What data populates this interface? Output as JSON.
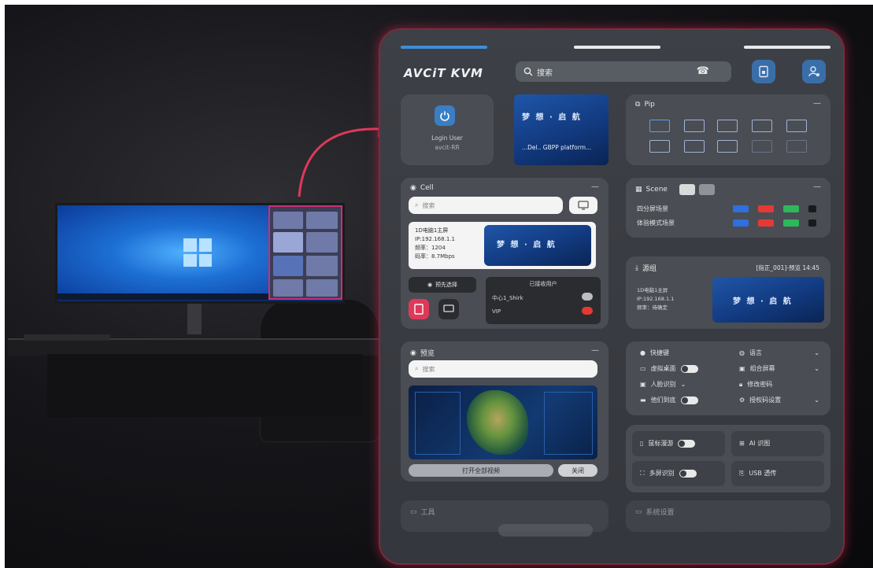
{
  "app": {
    "logo": "AVCiT KVM"
  },
  "search": {
    "placeholder": "搜索"
  },
  "login_card": {
    "title": "Login User",
    "user": "avcit-RR"
  },
  "thumb_top": {
    "caption": "...Del.. GBPP platform..."
  },
  "pip_card": {
    "title": "Pip"
  },
  "cell_card": {
    "title": "Cell",
    "search_placeholder": "搜索",
    "info": [
      "1D电脑1主屏",
      "IP:192.168.1.1",
      "频率：1204",
      "码率：8.7Mbps"
    ],
    "btn_left": "预先选择",
    "cluster_title": "已接收用户",
    "user1": "中心1_Shirk",
    "user2": "VIP"
  },
  "scene_card": {
    "title": "Scene",
    "rows": [
      "四分屏场景",
      "体验模式场景"
    ]
  },
  "source_card": {
    "title": "源组",
    "meta": "[指正_001]-预览 14:45",
    "info": [
      "1D电脑1主屏",
      "IP:192.168.1.1",
      "频率：待确定"
    ]
  },
  "monitor_card": {
    "title": "预览",
    "search_placeholder": "搜索",
    "bottom_btn": "打开全部视频",
    "bottom_pill": "关闭"
  },
  "settings_card": {
    "items": [
      {
        "label": "快捷键",
        "right": "语言"
      },
      {
        "label": "虚拟桌面",
        "right": "组合屏幕"
      },
      {
        "label": "人脸识别",
        "right": "修改密码"
      },
      {
        "label": "他们到底",
        "right": "授权码设置"
      }
    ]
  },
  "tools_card": {
    "items": [
      "鼠标漫游",
      "AI 识图",
      "多屏识别",
      "USB 透传"
    ]
  },
  "footer_card": {
    "left": "工具",
    "right": "系统设置"
  },
  "colors": {
    "accent_red": "#e0385a",
    "tag_blue": "#2f6fe0",
    "tag_red": "#e53935",
    "tag_green": "#2eb85c"
  }
}
